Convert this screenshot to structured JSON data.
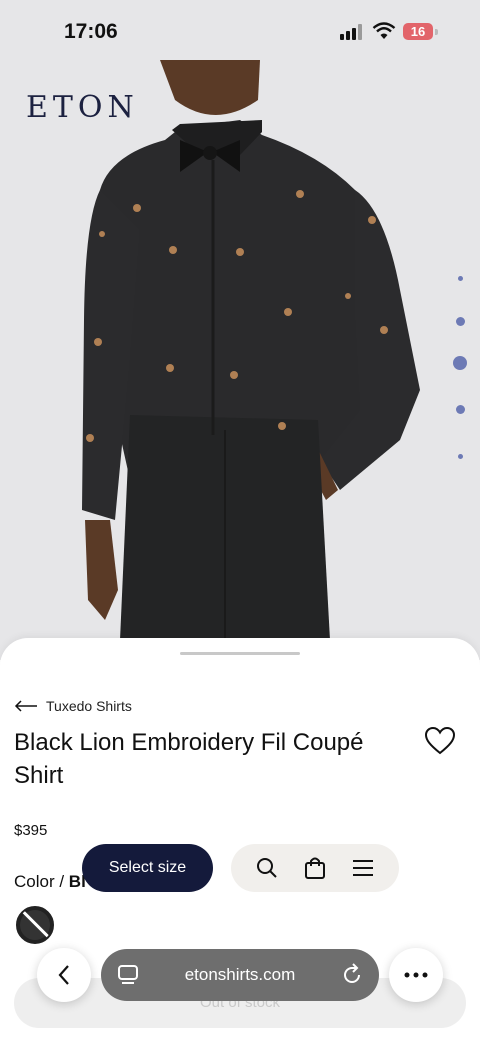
{
  "status": {
    "time": "17:06",
    "battery": "16"
  },
  "brand": {
    "logo": "ETON"
  },
  "gallery": {
    "slide_count": 5,
    "active_slide": 3
  },
  "product": {
    "breadcrumb": "Tuxedo Shirts",
    "title": "Black Lion Embroidery Fil Coupé Shirt",
    "price": "$395",
    "color_label": "Color / ",
    "color_value": "Bl",
    "stock_button": "Out of stock"
  },
  "site_nav": {
    "select_size": "Select size"
  },
  "browser": {
    "url": "etonshirts.com"
  },
  "colors": {
    "accent_navy": "#141a3b",
    "logo": "#1c2140",
    "dot": "#6d7ab5"
  }
}
